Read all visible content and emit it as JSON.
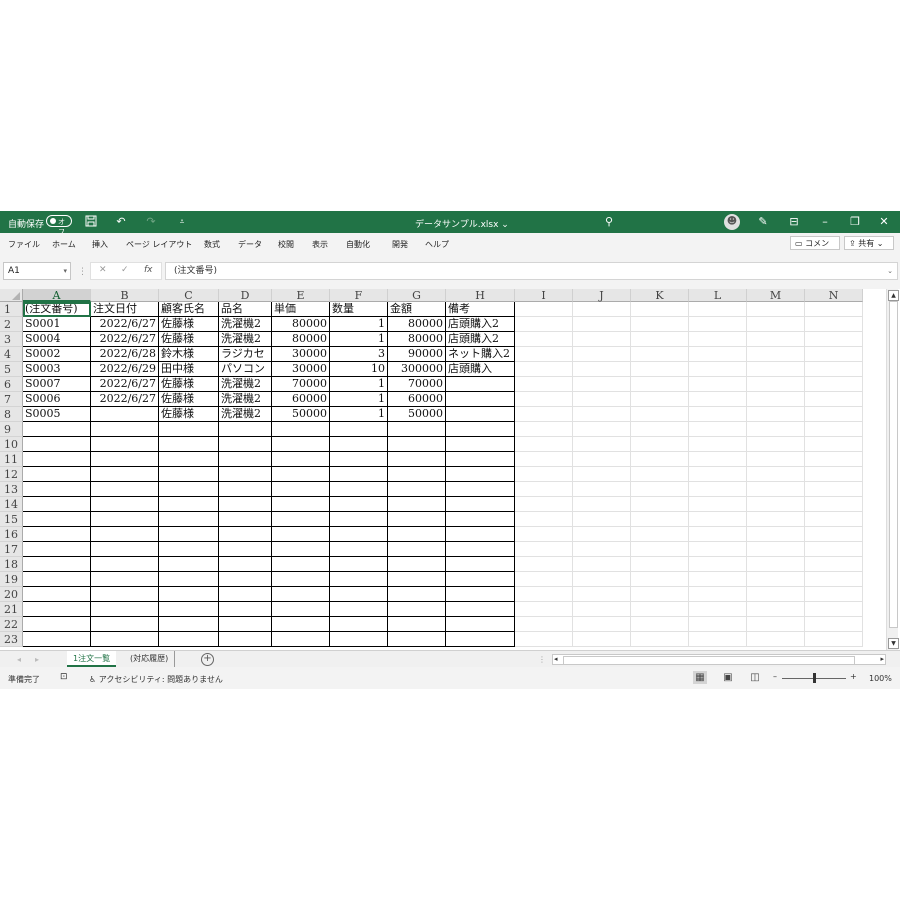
{
  "titlebar": {
    "autosave_label": "自動保存",
    "autosave_state": "オフ",
    "file_title": "データサンプル.xlsx ⌄",
    "icons": [
      "save-icon",
      "undo-icon",
      "redo-icon",
      "customize-icon",
      "search-icon",
      "avatar",
      "pen-icon",
      "ribbon-display-icon",
      "minimize-icon",
      "restore-icon",
      "close-icon"
    ]
  },
  "menu": {
    "tabs": [
      "ファイル",
      "ホーム",
      "挿入",
      "ページ レイアウト",
      "数式",
      "データ",
      "校閲",
      "表示",
      "自動化",
      "開発",
      "ヘルプ"
    ],
    "comment_button": "コメント",
    "share_button": "共有"
  },
  "formula": {
    "namebox": "A1",
    "content": "(注文番号)"
  },
  "grid": {
    "columns": [
      "A",
      "B",
      "C",
      "D",
      "E",
      "F",
      "G",
      "H",
      "I",
      "J",
      "K",
      "L",
      "M",
      "N"
    ],
    "header_row": [
      "(注文番号)",
      "注文日付",
      "顧客氏名",
      "品名",
      "単価",
      "数量",
      "金額",
      "備考"
    ],
    "data_rows": [
      [
        "S0001",
        "2022/6/27",
        "佐藤様",
        "洗濯機2",
        "80000",
        "1",
        "80000",
        "店頭購入2"
      ],
      [
        "S0004",
        "2022/6/27",
        "佐藤様",
        "洗濯機2",
        "80000",
        "1",
        "80000",
        "店頭購入2"
      ],
      [
        "S0002",
        "2022/6/28",
        "鈴木様",
        "ラジカセ",
        "30000",
        "3",
        "90000",
        "ネット購入2"
      ],
      [
        "S0003",
        "2022/6/29",
        "田中様",
        "パソコン",
        "30000",
        "10",
        "300000",
        "店頭購入"
      ],
      [
        "S0007",
        "2022/6/27",
        "佐藤様",
        "洗濯機2",
        "70000",
        "1",
        "70000",
        ""
      ],
      [
        "S0006",
        "2022/6/27",
        "佐藤様",
        "洗濯機2",
        "60000",
        "1",
        "60000",
        ""
      ],
      [
        "S0005",
        "",
        "佐藤様",
        "洗濯機2",
        "50000",
        "1",
        "50000",
        ""
      ]
    ],
    "row_numbers": [
      "1",
      "2",
      "3",
      "4",
      "5",
      "6",
      "7",
      "8",
      "9",
      "10",
      "11",
      "12",
      "13",
      "14",
      "15",
      "16",
      "17",
      "18",
      "19",
      "20",
      "21",
      "22",
      "23"
    ]
  },
  "sheets": {
    "tabs": [
      "1注文一覧",
      "(対応履歴)"
    ],
    "active": "1注文一覧"
  },
  "status": {
    "ready": "準備完了",
    "accessibility": "アクセシビリティ: 問題ありません",
    "zoom": "100%"
  },
  "colors": {
    "accent": "#217346"
  }
}
